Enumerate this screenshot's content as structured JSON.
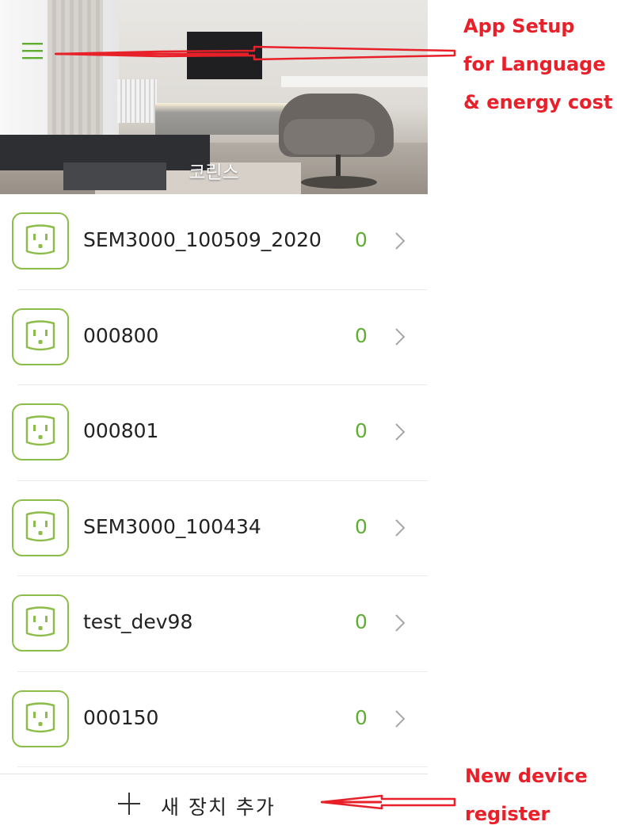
{
  "header": {
    "home_name": "코린스",
    "menu_icon": "hamburger-menu-icon",
    "menu_color": "#5fae32"
  },
  "devices": [
    {
      "name": "SEM3000_100509_2020",
      "value": "0",
      "icon": "smart-plug-icon"
    },
    {
      "name": "000800",
      "value": "0",
      "icon": "smart-plug-icon"
    },
    {
      "name": "000801",
      "value": "0",
      "icon": "smart-plug-icon"
    },
    {
      "name": "SEM3000_100434",
      "value": "0",
      "icon": "smart-plug-icon"
    },
    {
      "name": "test_dev98",
      "value": "0",
      "icon": "smart-plug-icon"
    },
    {
      "name": "000150",
      "value": "0",
      "icon": "smart-plug-icon"
    }
  ],
  "add_device": {
    "label": "새 장치 추가",
    "icon": "plus-icon"
  },
  "annotations": {
    "top": {
      "line1": "App Setup",
      "line2": "for Language",
      "line3": "& energy cost"
    },
    "bottom": {
      "line1": "New device",
      "line2": "register"
    }
  },
  "colors": {
    "accent_green": "#5fae32",
    "plug_border": "#8cbd4a",
    "annotation_red": "#e8202a"
  }
}
